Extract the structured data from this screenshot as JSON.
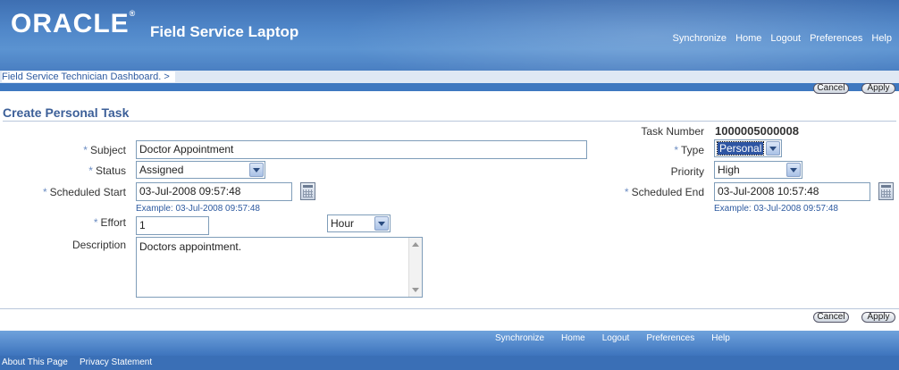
{
  "header": {
    "logo": "ORACLE",
    "app_title": "Field Service Laptop",
    "links": [
      "Synchronize",
      "Home",
      "Logout",
      "Preferences",
      "Help"
    ]
  },
  "breadcrumb": "Field Service Technician Dashboard.  >",
  "buttons": {
    "cancel": "Cancel",
    "apply": "Apply"
  },
  "page_title": "Create Personal Task",
  "form": {
    "task_number_label": "Task Number",
    "task_number": "1000005000008",
    "subject_label": "Subject",
    "subject": "Doctor Appointment",
    "type_label": "Type",
    "type": "Personal",
    "status_label": "Status",
    "status": "Assigned",
    "priority_label": "Priority",
    "priority": "High",
    "scheduled_start_label": "Scheduled Start",
    "scheduled_start": "03-Jul-2008 09:57:48",
    "scheduled_start_example": "Example: 03-Jul-2008 09:57:48",
    "scheduled_end_label": "Scheduled End",
    "scheduled_end": "03-Jul-2008 10:57:48",
    "scheduled_end_example": "Example: 03-Jul-2008 09:57:48",
    "effort_label": "Effort",
    "effort": "1",
    "effort_unit": "Hour",
    "description_label": "Description",
    "description": "Doctors appointment."
  },
  "footer": {
    "links": [
      "Synchronize",
      "Home",
      "Logout",
      "Preferences",
      "Help"
    ],
    "about": "About This Page",
    "privacy": "Privacy Statement"
  },
  "colors": {
    "brand_blue": "#3e78c0",
    "title_blue": "#3c5f98",
    "link_blue": "#2d5aa0"
  }
}
